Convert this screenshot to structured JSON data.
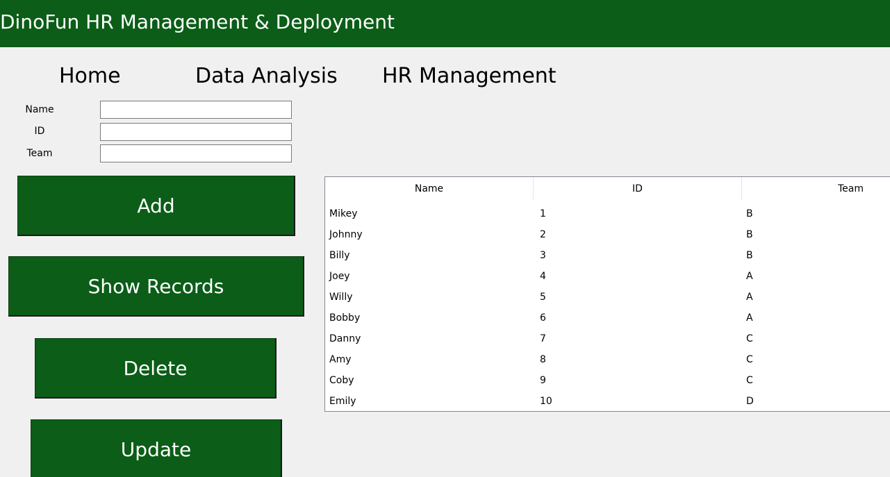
{
  "app": {
    "title": "DinoFun HR Management & Deployment"
  },
  "nav": {
    "home": "Home",
    "data_analysis": "Data Analysis",
    "hr_management": "HR Management"
  },
  "form": {
    "name_label": "Name",
    "id_label": "ID",
    "team_label": "Team",
    "name_value": "",
    "id_value": "",
    "team_value": ""
  },
  "buttons": {
    "add": "Add",
    "show_records": "Show Records",
    "delete": "Delete",
    "update": "Update"
  },
  "table": {
    "columns": [
      "Name",
      "ID",
      "Team"
    ],
    "rows": [
      [
        "Mikey",
        "1",
        "B"
      ],
      [
        "Johnny",
        "2",
        "B"
      ],
      [
        "Billy",
        "3",
        "B"
      ],
      [
        "Joey",
        "4",
        "A"
      ],
      [
        "Willy",
        "5",
        "A"
      ],
      [
        "Bobby",
        "6",
        "A"
      ],
      [
        "Danny",
        "7",
        "C"
      ],
      [
        "Amy",
        "8",
        "C"
      ],
      [
        "Coby",
        "9",
        "C"
      ],
      [
        "Emily",
        "10",
        "D"
      ]
    ]
  },
  "colors": {
    "brand_green": "#0b5d17",
    "background": "#f0f0f0"
  }
}
